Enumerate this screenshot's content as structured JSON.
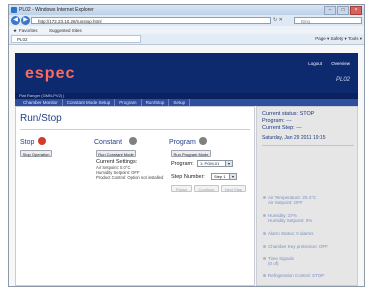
{
  "browser": {
    "window_title": "PL02 - Windows Internet Explorer",
    "address": "http://172.23.10.28/runstop.html",
    "search_placeholder": "Bing",
    "favorites_label": "Favorites",
    "suggested_sites": "Suggested Sites",
    "tab_label": "PL02",
    "command_bar": "Page ▾  Safety ▾  Tools ▾"
  },
  "header": {
    "logo": "espec",
    "links": [
      "Logout",
      "Overview"
    ],
    "model": "PL02",
    "subtitle": "Plat Ranger (GMN-PV2) |"
  },
  "nav": {
    "items": [
      "Chamber Monitor",
      "Constant Mode Setup",
      "Program",
      "Run/Stop",
      "Setup"
    ]
  },
  "main": {
    "title": "Run/Stop",
    "stop": {
      "title": "Stop",
      "button": "Stop Operation"
    },
    "constant": {
      "title": "Constant",
      "button": "Run Constant Mode",
      "current_settings": "Current Settings:",
      "details": [
        "Air Setpoint: 0.0°C",
        "Humidity Setpoint: OFF",
        "Product Control: Option not installed"
      ]
    },
    "program": {
      "title": "Program",
      "button": "Run Program Mode",
      "program_label": "Program:",
      "program_value": "1: PGM-01",
      "step_label": "Step Number:",
      "step_value": "Step 1",
      "pause": "Pause",
      "continue": "Continue",
      "next_step": "Next Step"
    }
  },
  "sidebar": {
    "status_lines": [
      "Current status: STOP",
      "Program: ---",
      "Current Step: ---"
    ],
    "datetime": "Saturday, Jan 29 2011 19:15",
    "items": [
      "Air Temperature: 20.4°C",
      "Air Setpoint: OFF",
      "Humidity: 37%",
      "Humidity Setpoint: 0%",
      "Alarm Status: 0 alarms",
      "Chamber Key protection: OFF",
      "Time Signals",
      "(0 of)",
      "Refrigeration Control: STOP"
    ]
  },
  "colors": {
    "header_bg": "#0e2a6f",
    "logo": "#ff6a5c",
    "nav_bg": "#2f4e9c",
    "stop_dot": "#d43a2a",
    "constant_dot": "#808080",
    "program_dot": "#808080",
    "title_text": "#26418a"
  }
}
